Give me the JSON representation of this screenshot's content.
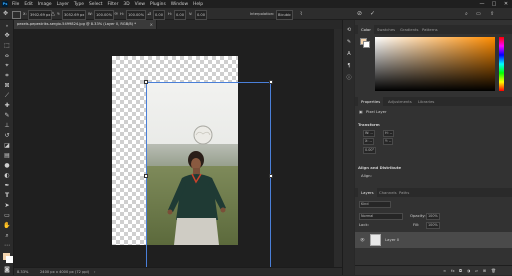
{
  "app": {
    "logo": "Ps"
  },
  "menu": [
    "File",
    "Edit",
    "Image",
    "Layer",
    "Type",
    "Select",
    "Filter",
    "3D",
    "View",
    "Plugins",
    "Window",
    "Help"
  ],
  "window_controls": {
    "minimize": "—",
    "maximize": "□",
    "close": "✕"
  },
  "options_bar": {
    "x_label": "X:",
    "x_value": "3902.69 px",
    "y_label": "Y:",
    "y_value": "3052.69 px",
    "w_label": "W:",
    "w_value": "100.00%",
    "h_label": "H:",
    "h_value": "100.00%",
    "angle_value": "0.00",
    "hskew_label": "H:",
    "hskew_value": "0.00",
    "vskew_label": "V:",
    "vskew_value": "0.00",
    "interpolation_label": "Interpolation:",
    "interpolation_value": "Bicubic"
  },
  "document": {
    "tab_title": "pexels-pepestriks-sergio-5499824.jpg @ 8.33% (Layer 0, RGB/8) *",
    "zoom": "8.33%",
    "info": "2400 px x 4000 px (72 ppi)"
  },
  "panels": {
    "color_tabs": [
      "Color",
      "Swatches",
      "Gradients",
      "Patterns"
    ],
    "colors": {
      "foreground": "#f3d4ae",
      "background": "#ffffff",
      "accent": "#4a7fd8"
    },
    "properties_tabs": [
      "Properties",
      "Adjustments",
      "Libraries"
    ],
    "layer_type": "Pixel Layer",
    "transform_label": "Transform",
    "transform_fields": [
      "W: --",
      "H: --",
      "X: --",
      "Y: --",
      "0.00°"
    ],
    "align_label": "Align and Distribute",
    "align_sub": "Align:",
    "layers_tabs": [
      "Layers",
      "Channels",
      "Paths"
    ],
    "kind_label": "Kind",
    "blend_mode": "Normal",
    "opacity_label": "Opacity:",
    "opacity_value": "100%",
    "lock_label": "Lock:",
    "fill_label": "Fill:",
    "fill_value": "100%",
    "layers": [
      {
        "name": "Layer 0",
        "visible": true
      }
    ]
  }
}
